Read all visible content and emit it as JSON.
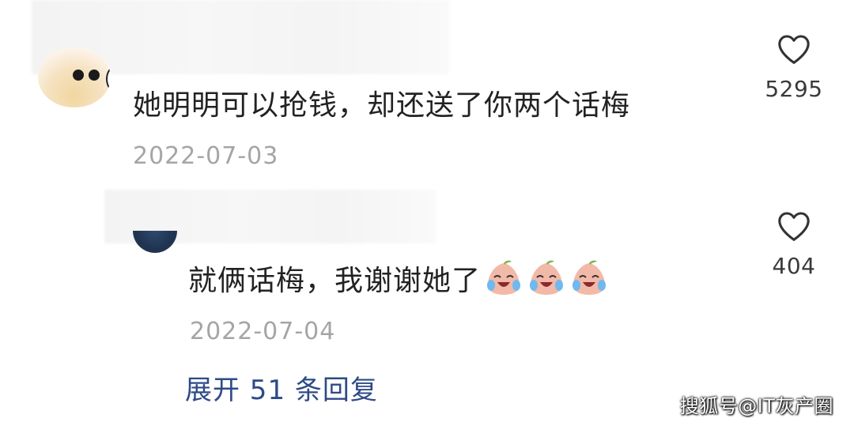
{
  "comments": [
    {
      "text": "她明明可以抢钱，却还送了你两个话梅",
      "date": "2022-07-03",
      "likes": "5295",
      "like_icon": "heart-outline-icon"
    },
    {
      "text": "就俩话梅，我谢谢她了",
      "date": "2022-07-04",
      "likes": "404",
      "like_icon": "heart-outline-icon",
      "emoji": [
        "crying-laughing-plum-emoji",
        "crying-laughing-plum-emoji",
        "crying-laughing-plum-emoji"
      ]
    }
  ],
  "expand_replies_label": "展开 51 条回复",
  "watermark": "搜狐号@IT灰产圈",
  "colors": {
    "text": "#222222",
    "date": "#a5a5a5",
    "link": "#2e4a86",
    "icon": "#333333"
  }
}
